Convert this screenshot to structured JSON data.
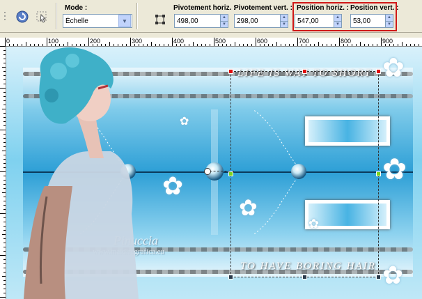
{
  "toolbar": {
    "mode_label": "Mode :",
    "mode_value": "Échelle",
    "pivot_h_label": "Pivotement horiz. :",
    "pivot_h_value": "498,00",
    "pivot_v_label": "Pivotement vert. :",
    "pivot_v_value": "298,00",
    "pos_h_label": "Position horiz. :",
    "pos_h_value": "547,00",
    "pos_v_label": "Position vert. :",
    "pos_v_value": "53,00",
    "highlight_color": "#d01818"
  },
  "ruler": {
    "h_labels": [
      "0",
      "100",
      "200",
      "300",
      "400",
      "500",
      "600",
      "700",
      "800",
      "900"
    ]
  },
  "canvas": {
    "text_top": "LIFE IS WAY TO SHORT",
    "text_bottom": "TO HAVE BORING HAIR",
    "watermark_name": "Pinuccia",
    "watermark_url": "www.maidiregrafica.eu"
  }
}
